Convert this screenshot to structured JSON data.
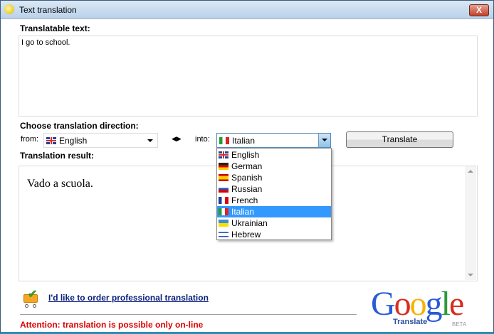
{
  "window": {
    "title": "Text translation",
    "close_label": "X"
  },
  "source": {
    "label": "Translatable text:",
    "value": "I go to school."
  },
  "direction": {
    "label": "Choose translation direction:",
    "from_label": "from:",
    "from_value": "English",
    "swap_icon": "swap-arrows-icon",
    "into_label": "into:",
    "into_value": "Italian",
    "options": [
      "English",
      "German",
      "Spanish",
      "Russian",
      "French",
      "Italian",
      "Ukrainian",
      "Hebrew"
    ],
    "selected_index": 5
  },
  "translate_button": "Translate",
  "result": {
    "label": "Translation result:",
    "value": "Vado a scuola."
  },
  "footer": {
    "order_link": "I'd like to order professional translation",
    "attention": "Attention: translation is possible only on-line",
    "logo_text": "Google",
    "logo_sub": "Translate",
    "logo_beta": "BETA"
  }
}
